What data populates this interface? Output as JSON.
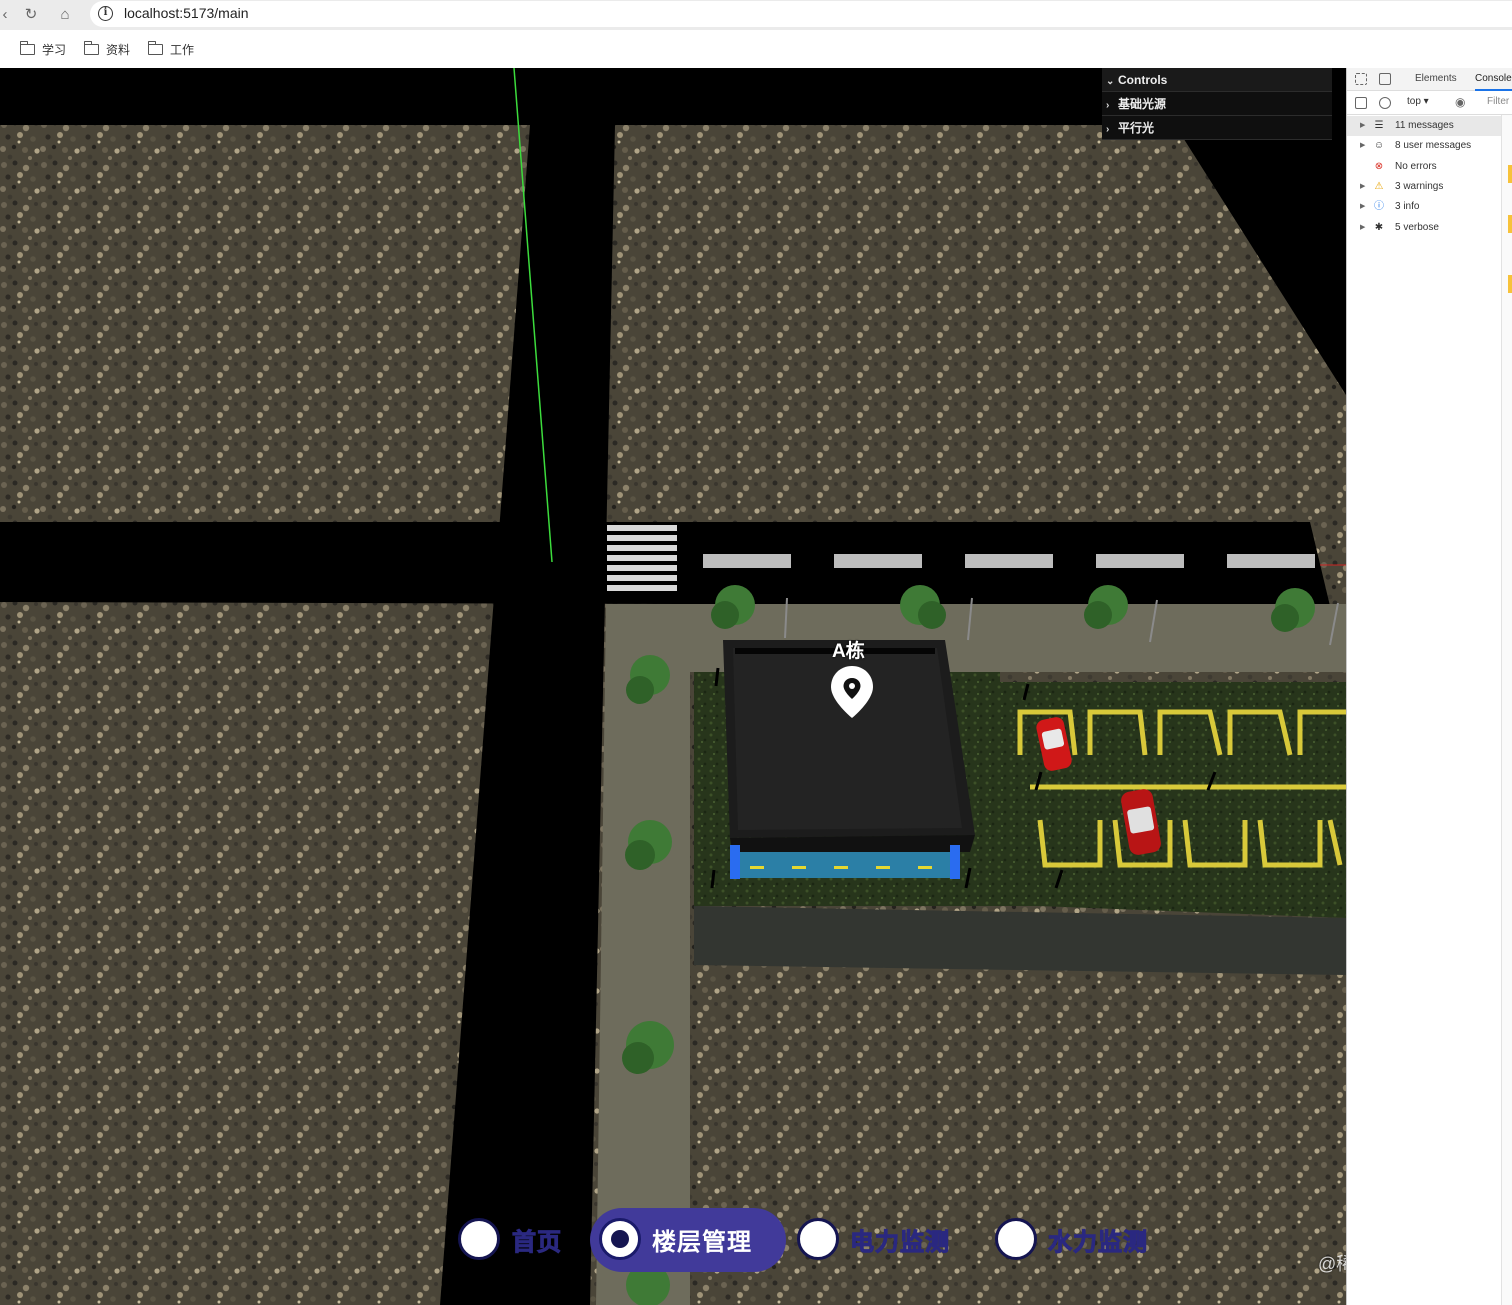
{
  "browser": {
    "url": "localhost:5173/main",
    "bookmarks": [
      {
        "label": "学习",
        "icon": "folder-icon"
      },
      {
        "label": "资料",
        "icon": "folder-icon"
      },
      {
        "label": "工作",
        "icon": "folder-icon"
      }
    ]
  },
  "gui": {
    "title": "Controls",
    "folders": [
      "基础光源",
      "平行光"
    ]
  },
  "scene": {
    "building_label": "A栋"
  },
  "menu": {
    "items": [
      {
        "label": "首页",
        "active": false
      },
      {
        "label": "楼层管理",
        "active": true
      },
      {
        "label": "电力监测",
        "active": false
      },
      {
        "label": "水力监测",
        "active": false
      }
    ]
  },
  "watermark": "@稀土掘金技术社区",
  "devtools": {
    "tabs": [
      "Elements",
      "Console"
    ],
    "context_select": "top",
    "filter_placeholder": "Filter",
    "sidebar": [
      {
        "label": "11 messages",
        "icon": "list-icon"
      },
      {
        "label": "8 user messages",
        "icon": "user-icon"
      },
      {
        "label": "No errors",
        "icon": "error-icon"
      },
      {
        "label": "3 warnings",
        "icon": "warning-icon"
      },
      {
        "label": "3 info",
        "icon": "info-icon"
      },
      {
        "label": "5 verbose",
        "icon": "bug-icon"
      }
    ]
  },
  "colors": {
    "menu_active": "#413a9a",
    "menu_text": "#3c3a8e",
    "road": "#000000",
    "grass": "#2a3a1e",
    "parking_line": "#d8c93a"
  }
}
